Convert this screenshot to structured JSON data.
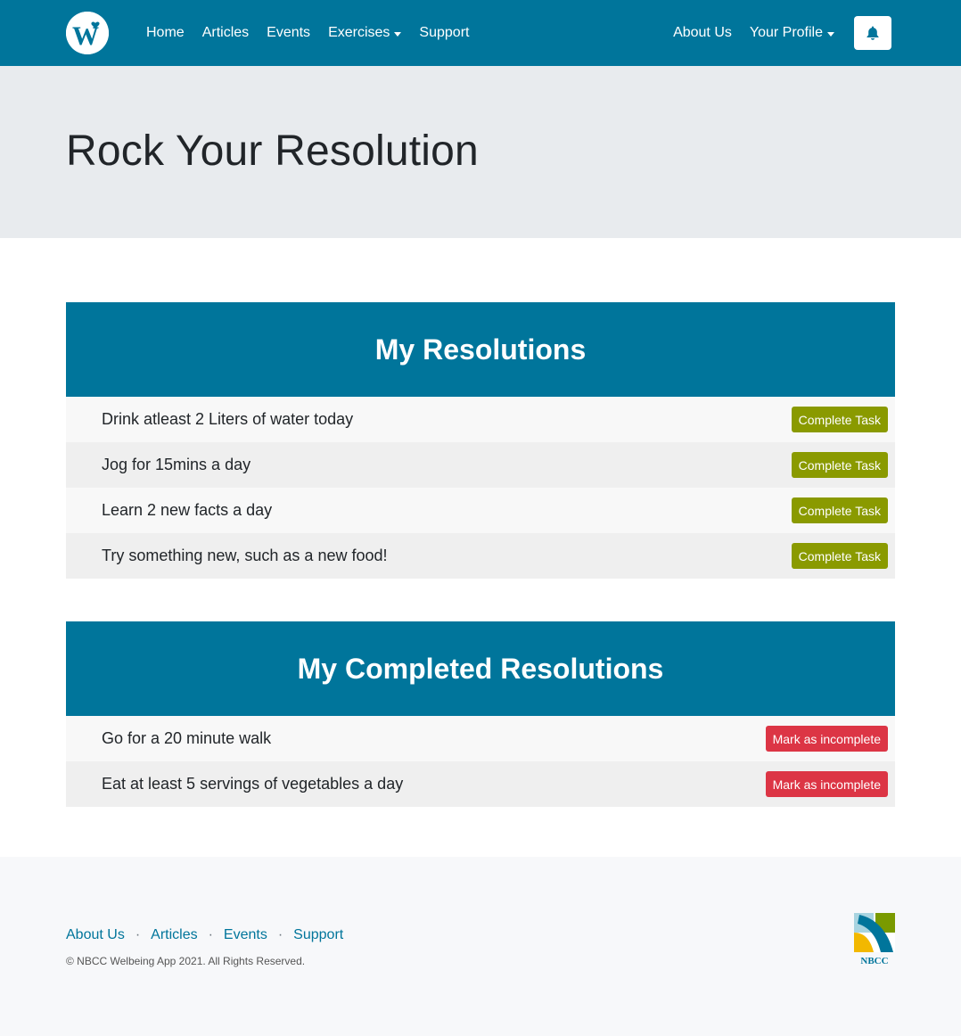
{
  "nav": {
    "logo_icon": "wellbeing-logo-icon",
    "left_links": [
      "Home",
      "Articles",
      "Events",
      "Exercises",
      "Support"
    ],
    "right_links": [
      "About Us",
      "Your Profile"
    ],
    "bell_icon": "bell-icon",
    "brand_color": "#00759b"
  },
  "hero": {
    "title": "Rock Your Resolution",
    "background": "#e8ebee"
  },
  "resolutions": {
    "title": "My Resolutions",
    "button_label": "Complete Task",
    "button_color": "#8a9a00",
    "items": [
      "Drink atleast 2 Liters of water today",
      "Jog for 15mins a day",
      "Learn 2 new facts a day",
      "Try something new, such as a new food!"
    ]
  },
  "completed": {
    "title": "My Completed Resolutions",
    "button_label": "Mark as incomplete",
    "button_color": "#dc3545",
    "items": [
      "Go for a 20 minute walk",
      "Eat at least 5 servings of vegetables a day"
    ]
  },
  "footer": {
    "links": [
      "About Us",
      "Articles",
      "Events",
      "Support"
    ],
    "separator": "·",
    "copyright": "© NBCC Welbeing App 2021. All Rights Reserved.",
    "logo_text": "NBCC"
  }
}
